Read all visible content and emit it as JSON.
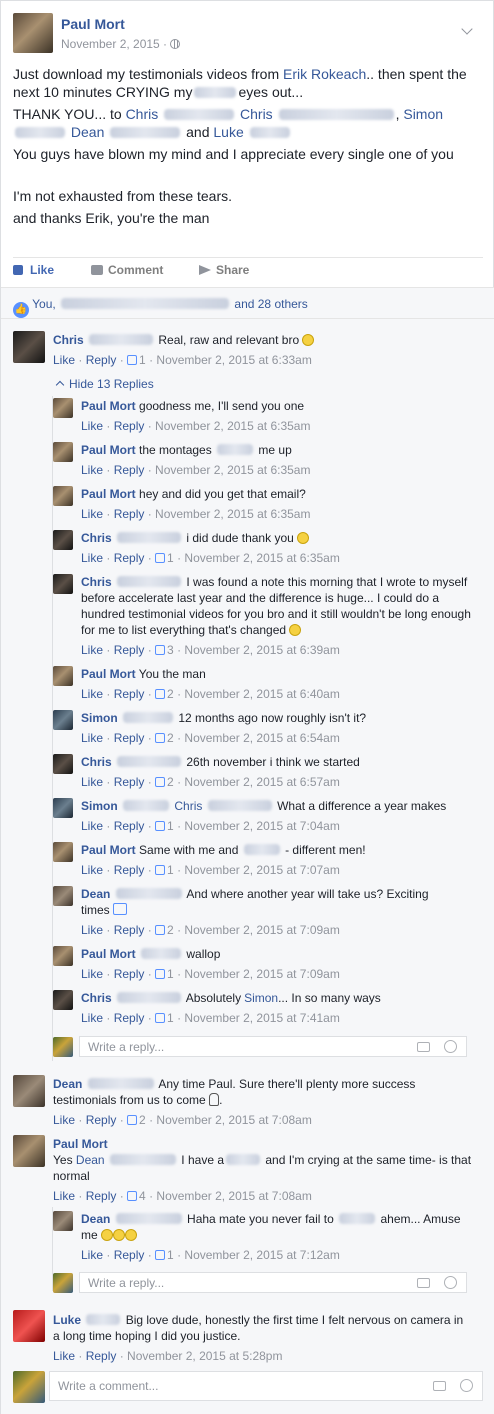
{
  "post": {
    "author": "Paul Mort",
    "date": "November 2, 2015 ·",
    "line1a": "Just download my testimonials videos from",
    "line1_link": "Erik Rokeach",
    "line1b": ".. then spent the next 10 minutes CRYING my",
    "line1c": "eyes out...",
    "line2a": "THANK YOU... to",
    "line2_chris1": "Chris",
    "line2_chris2": "Chris",
    "line2_simon": "Simon",
    "line2_dean": "Dean",
    "line2_and": "and",
    "line2_luke": "Luke",
    "line3": "You guys have blown my mind and I appreciate every single one of you",
    "line4": "I'm not exhausted from these tears.",
    "line5": "and thanks Erik, you're the man"
  },
  "actions": {
    "like": "Like",
    "comment": "Comment",
    "share": "Share"
  },
  "reactions": {
    "you": "You,",
    "others": "and 28 others"
  },
  "footer": {
    "like": "Like",
    "reply": "Reply"
  },
  "hide_replies": "Hide 13 Replies",
  "comments": [
    {
      "name": "Chris",
      "text": "Real, raw and relevant bro",
      "likes": "1",
      "time": "November 2, 2015 at 6:33am"
    },
    {
      "name": "Paul Mort",
      "text": "goodness me, I'll send you one",
      "likes": "",
      "time": "November 2, 2015 at 6:35am"
    },
    {
      "name": "Paul Mort",
      "text": "the montages",
      "text2": "me up",
      "likes": "",
      "time": "November 2, 2015 at 6:35am"
    },
    {
      "name": "Paul Mort",
      "text": "hey and did you get that email?",
      "likes": "",
      "time": "November 2, 2015 at 6:35am"
    },
    {
      "name": "Chris",
      "text": "i did dude thank you",
      "likes": "1",
      "time": "November 2, 2015 at 6:35am"
    },
    {
      "name": "Chris",
      "text": "I was found a note this morning that I wrote to myself before accelerate last year and the difference is huge... I could do a hundred testimonial videos for you bro and it still wouldn't be long enough for me to list everything that's changed",
      "likes": "3",
      "time": "November 2, 2015 at 6:39am"
    },
    {
      "name": "Paul Mort",
      "text": "You the man",
      "likes": "2",
      "time": "November 2, 2015 at 6:40am"
    },
    {
      "name": "Simon",
      "text": "12 months ago now roughly isn't it?",
      "likes": "2",
      "time": "November 2, 2015 at 6:54am"
    },
    {
      "name": "Chris",
      "text": "26th november i think we started",
      "likes": "2",
      "time": "November 2, 2015 at 6:57am"
    },
    {
      "name": "Simon",
      "mention": "Chris",
      "text": "What a difference a year makes",
      "likes": "1",
      "time": "November 2, 2015 at 7:04am"
    },
    {
      "name": "Paul Mort",
      "text": "Same with me and",
      "text2": "- different men!",
      "likes": "1",
      "time": "November 2, 2015 at 7:07am"
    },
    {
      "name": "Dean",
      "text": "And where another year will take us? Exciting times",
      "likes": "2",
      "time": "November 2, 2015 at 7:09am"
    },
    {
      "name": "Paul Mort",
      "text": "wallop",
      "likes": "1",
      "time": "November 2, 2015 at 7:09am"
    },
    {
      "name": "Chris",
      "text": "Absolutely",
      "mention": "Simon",
      "text2": "... In so many ways",
      "likes": "1",
      "time": "November 2, 2015 at 7:41am"
    },
    {
      "name": "Dean",
      "text": "Any time Paul. Sure there'll plenty more success testimonials from us to come",
      "likes": "2",
      "time": "November 2, 2015 at 7:08am"
    },
    {
      "name": "Paul Mort",
      "text": "Yes",
      "mention": "Dean",
      "text2": "I have a",
      "text3": "and I'm crying at the same time- is that normal",
      "likes": "4",
      "time": "November 2, 2015 at 7:08am"
    },
    {
      "name": "Dean",
      "text": "Haha mate you never fail to",
      "text2": "ahem... Amuse me",
      "likes": "1",
      "time": "November 2, 2015 at 7:12am"
    },
    {
      "name": "Luke",
      "text": "Big love dude, honestly the first time I felt nervous on camera in a long time hoping I did you justice.",
      "likes": "",
      "time": "November 2, 2015 at 5:28pm"
    }
  ],
  "write_reply": "Write a reply...",
  "write_comment": "Write a comment..."
}
